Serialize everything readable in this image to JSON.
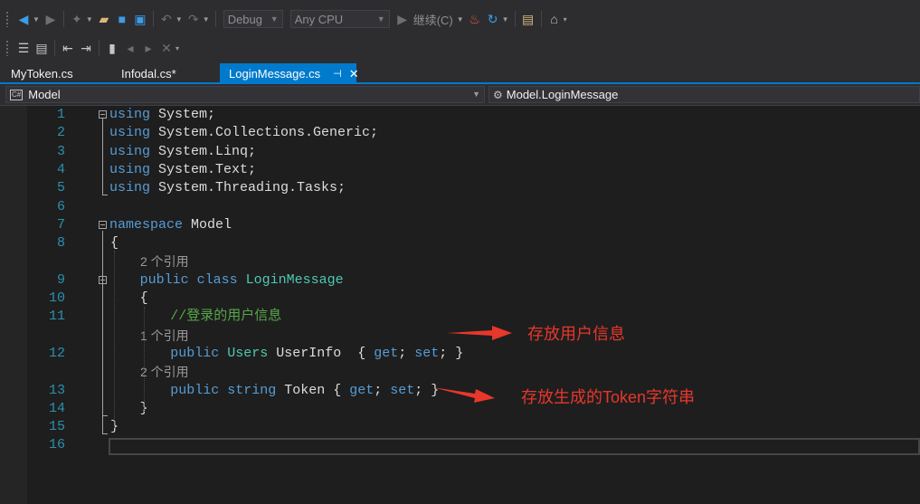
{
  "toolbar": {
    "row1": {
      "icons": [
        "back-icon",
        "forward-icon",
        "new-project-icon",
        "open-file-icon",
        "save-icon",
        "save-all-icon",
        "undo-icon",
        "redo-icon",
        "start-icon",
        "hot-reload-icon",
        "restart-icon",
        "solution-explorer-icon",
        "home-icon"
      ],
      "config_value": "Debug",
      "platform_value": "Any CPU",
      "run_label": "继续(C)"
    },
    "row2": {
      "icons": [
        "comment-icon",
        "uncomment-icon",
        "outdent-icon",
        "indent-icon",
        "bookmark-icon",
        "prev-bookmark-icon",
        "next-bookmark-icon",
        "clear-bookmarks-icon"
      ]
    }
  },
  "tabs": [
    {
      "label": "MyToken.cs",
      "active": false
    },
    {
      "label": "Infodal.cs*",
      "active": false
    },
    {
      "label": "LoginMessage.cs",
      "active": true,
      "pin": "⊣",
      "close": "✕"
    }
  ],
  "navbar": {
    "project": "Model",
    "member": "Model.LoginMessage"
  },
  "code": {
    "lines": [
      {
        "n": "1",
        "parts": [
          [
            "kw",
            "using"
          ],
          [
            "tx",
            " System;"
          ]
        ]
      },
      {
        "n": "2",
        "parts": [
          [
            "kw",
            "using"
          ],
          [
            "tx",
            " System.Collections.Generic;"
          ]
        ]
      },
      {
        "n": "3",
        "parts": [
          [
            "kw",
            "using"
          ],
          [
            "tx",
            " System.Linq;"
          ]
        ]
      },
      {
        "n": "4",
        "parts": [
          [
            "kw",
            "using"
          ],
          [
            "tx",
            " System.Text;"
          ]
        ]
      },
      {
        "n": "5",
        "parts": [
          [
            "kw",
            "using"
          ],
          [
            "tx",
            " System.Threading.Tasks;"
          ]
        ]
      },
      {
        "n": "6",
        "parts": []
      },
      {
        "n": "7",
        "parts": [
          [
            "kw",
            "namespace"
          ],
          [
            "tx",
            " Model"
          ]
        ]
      },
      {
        "n": "8",
        "parts": [
          [
            "tx",
            "{"
          ]
        ]
      },
      {
        "lens": "2 个引用"
      },
      {
        "n": "9",
        "parts": [
          [
            "kw",
            "public class "
          ],
          [
            "ty",
            "LoginMessage"
          ]
        ]
      },
      {
        "n": "10",
        "parts": [
          [
            "tx",
            "{"
          ]
        ]
      },
      {
        "n": "11",
        "parts": [
          [
            "cm",
            "//登录的用户信息"
          ]
        ]
      },
      {
        "lens": "1 个引用"
      },
      {
        "n": "12",
        "parts": [
          [
            "kw",
            "public "
          ],
          [
            "ty",
            "Users"
          ],
          [
            "tx",
            " UserInfo  { "
          ],
          [
            "kw",
            "get"
          ],
          [
            "tx",
            "; "
          ],
          [
            "kw",
            "set"
          ],
          [
            "tx",
            "; }"
          ]
        ]
      },
      {
        "lens": "2 个引用"
      },
      {
        "n": "13",
        "parts": [
          [
            "kw",
            "public string"
          ],
          [
            "tx",
            " Token { "
          ],
          [
            "kw",
            "get"
          ],
          [
            "tx",
            "; "
          ],
          [
            "kw",
            "set"
          ],
          [
            "tx",
            "; }"
          ]
        ]
      },
      {
        "n": "14",
        "parts": [
          [
            "tx",
            "}"
          ]
        ]
      },
      {
        "n": "15",
        "parts": [
          [
            "tx",
            "}"
          ]
        ]
      },
      {
        "n": "16",
        "parts": []
      }
    ]
  },
  "annotations": {
    "user_info": "存放用户信息",
    "token": "存放生成的Token字符串",
    "arrow_color": "#e8372b"
  }
}
